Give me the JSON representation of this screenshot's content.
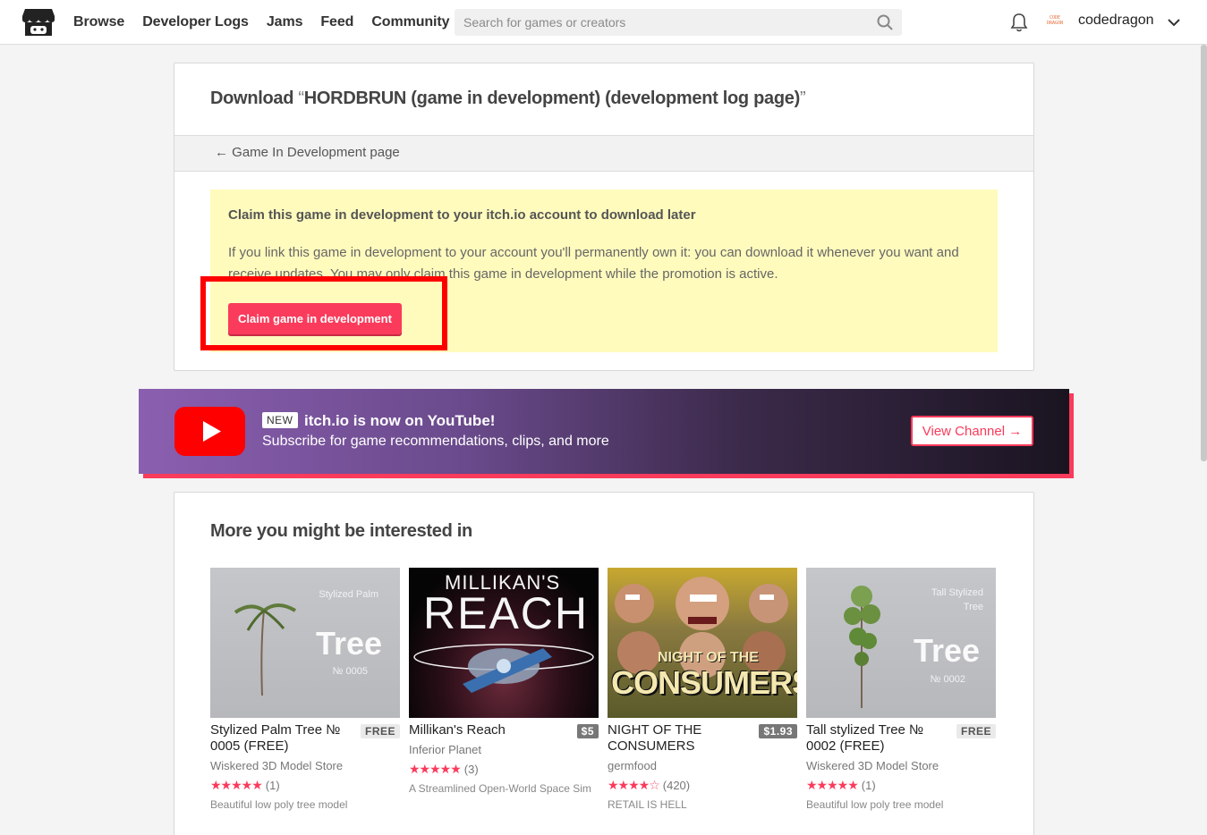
{
  "header": {
    "nav": [
      "Browse",
      "Developer Logs",
      "Jams",
      "Feed",
      "Community"
    ],
    "search_placeholder": "Search for games or creators",
    "avatar_text": "CODE DRAGON",
    "username": "codedragon"
  },
  "download": {
    "title_prefix": "Download ",
    "open_quote": "“",
    "title": "HORDBRUN (game in development) (development log page)",
    "close_quote": "”",
    "back_link": "← Game In Development page",
    "claim_heading": "Claim this game in development to your itch.io account to download later",
    "claim_text": "If you link this game in development to your account you'll permanently own it: you can download it whenever you want and receive updates. You may only claim this game in development while the promotion is active.",
    "claim_button": "Claim game in development"
  },
  "youtube": {
    "badge": "NEW",
    "title": "itch.io is now on YouTube!",
    "subtitle": "Subscribe for game recommendations, clips, and more",
    "button": "View Channel →"
  },
  "recommendations": {
    "heading": "More you might be interested in",
    "games": [
      {
        "name": "Stylized Palm Tree № 0005 (FREE)",
        "price": "FREE",
        "author": "Wiskered 3D Model Store",
        "stars": "★★★★★",
        "rating_count": "(1)",
        "description": "Beautiful low poly tree model",
        "thumb_caption_small": "Stylized Palm",
        "thumb_caption_big": "Tree",
        "thumb_caption_num": "№ 0005"
      },
      {
        "name": "Millikan's Reach",
        "price": "$5",
        "author": "Inferior Planet",
        "stars": "★★★★★",
        "rating_count": "(3)",
        "description": "A Streamlined Open-World Space Sim",
        "thumb_caption_small": "MILLIKAN'S",
        "thumb_caption_big": "REACH"
      },
      {
        "name": "NIGHT OF THE CONSUMERS",
        "price": "$1.93",
        "author": "germfood",
        "stars": "★★★★",
        "stars_empty": "☆",
        "rating_count": "(420)",
        "description": "RETAIL IS HELL",
        "thumb_caption_small": "NIGHT OF THE",
        "thumb_caption_big": "CONSUMERS"
      },
      {
        "name": "Tall stylized Tree № 0002 (FREE)",
        "price": "FREE",
        "author": "Wiskered 3D Model Store",
        "stars": "★★★★★",
        "rating_count": "(1)",
        "description": "Beautiful low poly tree model",
        "thumb_caption_small": "Tall Stylized Tree",
        "thumb_caption_big": "Tree",
        "thumb_caption_num": "№ 0002"
      }
    ]
  },
  "colors": {
    "accent": "#fa3b5b",
    "claim_bg": "#fffbbd",
    "highlight": "#ff0000"
  }
}
